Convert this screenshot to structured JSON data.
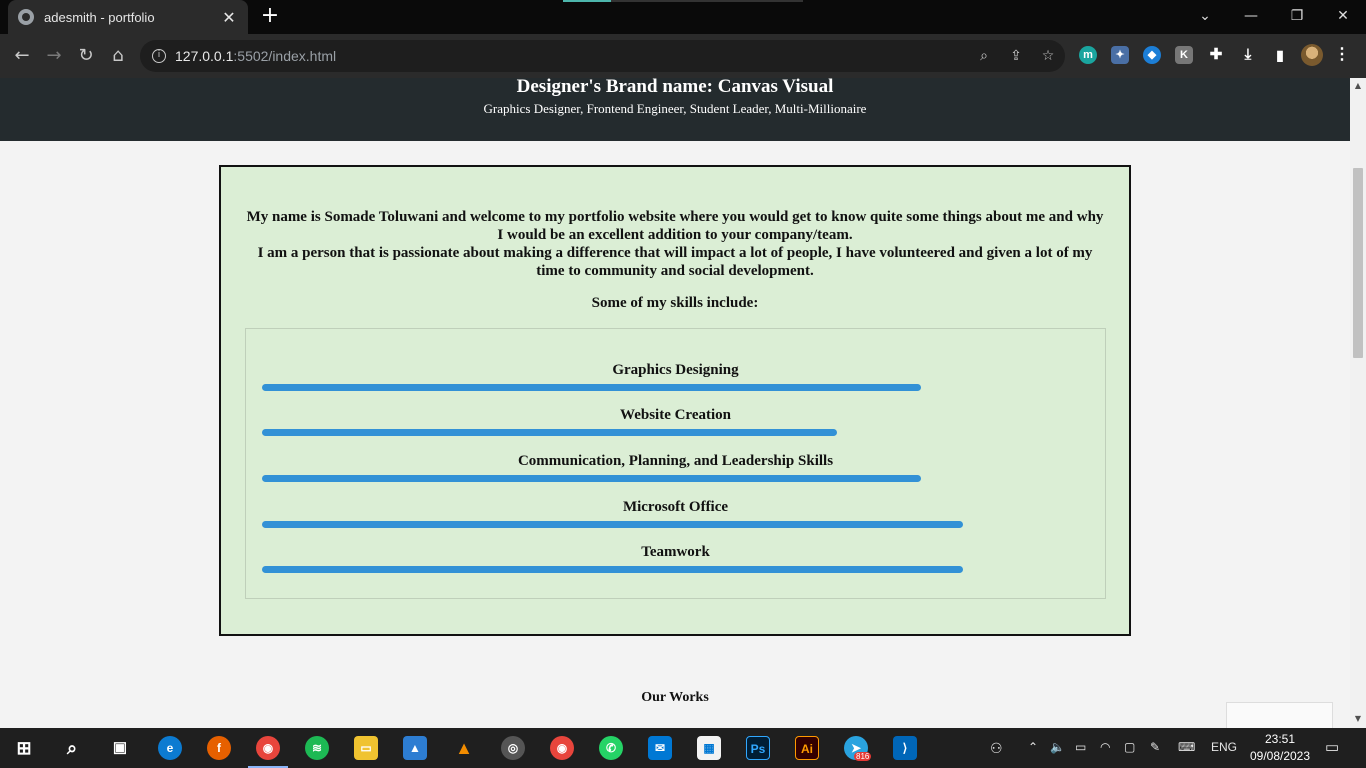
{
  "browser": {
    "tab_title": "adesmith - portfolio",
    "tab_close": "✕",
    "new_tab": "+",
    "url_host": "127.0.0.1",
    "url_path": ":5502/index.html",
    "window_controls": [
      "⌄",
      "—",
      "❐",
      "✕"
    ]
  },
  "header": {
    "title": "Designer's Brand name: Canvas Visual",
    "subtitle": "Graphics Designer, Frontend Engineer, Student Leader, Multi-Millionaire"
  },
  "about": {
    "intro_line1": "My name is Somade Toluwani and welcome to my portfolio website where you would get to know quite some things about me and why I would be an excellent addition to your company/team.",
    "intro_line2": "I am a person that is passionate about making a difference that will impact a lot of people, I have volunteered and given a lot of my time to community and social development.",
    "skills_heading": "Some of my skills include:",
    "skills": [
      {
        "label": "Graphics Designing",
        "level": 0.78
      },
      {
        "label": "Website Creation",
        "level": 0.68
      },
      {
        "label": "Communication, Planning, and Leadership Skills",
        "level": 0.78
      },
      {
        "label": "Microsoft Office",
        "level": 0.83
      },
      {
        "label": "Teamwork",
        "level": 0.83
      }
    ],
    "bar_color": "#3291d6"
  },
  "works": {
    "heading": "Our Works"
  },
  "taskbar": {
    "language": "ENG",
    "time": "23:51",
    "date": "09/08/2023",
    "telegram_badge": "816"
  }
}
